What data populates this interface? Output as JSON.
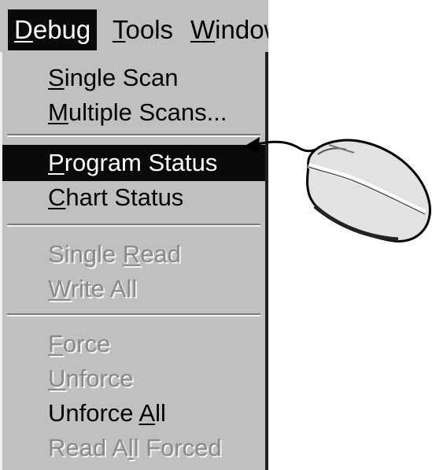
{
  "menubar": {
    "items": [
      {
        "pre": "",
        "key": "D",
        "post": "ebug",
        "active": true
      },
      {
        "pre": "",
        "key": "T",
        "post": "ools",
        "active": false
      },
      {
        "pre": "",
        "key": "W",
        "post": "indow",
        "active": false
      }
    ]
  },
  "debug_menu": {
    "items": [
      {
        "pre": "",
        "key": "S",
        "post": "ingle Scan",
        "state": "enabled"
      },
      {
        "pre": "",
        "key": "M",
        "post": "ultiple Scans...",
        "state": "enabled"
      },
      {
        "pre": "",
        "key": "P",
        "post": "rogram Status",
        "state": "highlighted"
      },
      {
        "pre": "",
        "key": "C",
        "post": "hart Status",
        "state": "enabled"
      },
      {
        "pre": "Single ",
        "key": "R",
        "post": "ead",
        "state": "disabled"
      },
      {
        "pre": "",
        "key": "W",
        "post": "rite All",
        "state": "disabled"
      },
      {
        "pre": "",
        "key": "F",
        "post": "orce",
        "state": "disabled"
      },
      {
        "pre": "",
        "key": "U",
        "post": "nforce",
        "state": "disabled"
      },
      {
        "pre": "Unforce ",
        "key": "A",
        "post": "ll",
        "state": "enabled"
      },
      {
        "pre": "Read A",
        "key": "l",
        "post": "l Forced",
        "state": "disabled"
      }
    ]
  },
  "colors": {
    "menu_background": "#c0c0c0",
    "highlight_background": "#0a0a0a",
    "highlight_text": "#ffffff",
    "disabled_text": "#8a8a8a"
  },
  "icons": {
    "pointer": "arrow-pointer-icon",
    "mouse": "computer-mouse-icon"
  }
}
